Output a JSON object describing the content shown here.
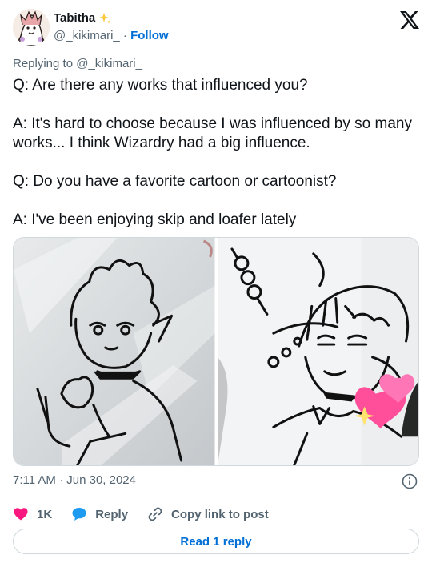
{
  "author": {
    "display_name": "Tabitha",
    "handle": "@_kikimari_",
    "separator": "·",
    "follow_label": "Follow"
  },
  "replying_to": "Replying to @_kikimari_",
  "tweet": {
    "paragraphs": [
      "Q: Are there any works that influenced you?",
      "A: It's hard to choose because I was influenced by so many works... I think Wizardry had a big influence.",
      "Q: Do you have a favorite cartoon or cartoonist?",
      "A: I've been enjoying skip and loafer lately"
    ]
  },
  "timestamp": "7:11 AM · Jun 30, 2024",
  "actions": {
    "like_count": "1K",
    "reply_label": "Reply",
    "copy_label": "Copy link to post"
  },
  "read_reply_label": "Read 1 reply",
  "colors": {
    "like": "#f91880",
    "reply": "#1d9bf0",
    "link": "#006fd6",
    "muted": "#536471"
  },
  "icons": {
    "brand": "x-logo-icon",
    "badge": "sparkle-icon",
    "like": "heart-icon",
    "reply": "speech-bubble-icon",
    "copy": "chain-link-icon",
    "info": "info-icon"
  }
}
